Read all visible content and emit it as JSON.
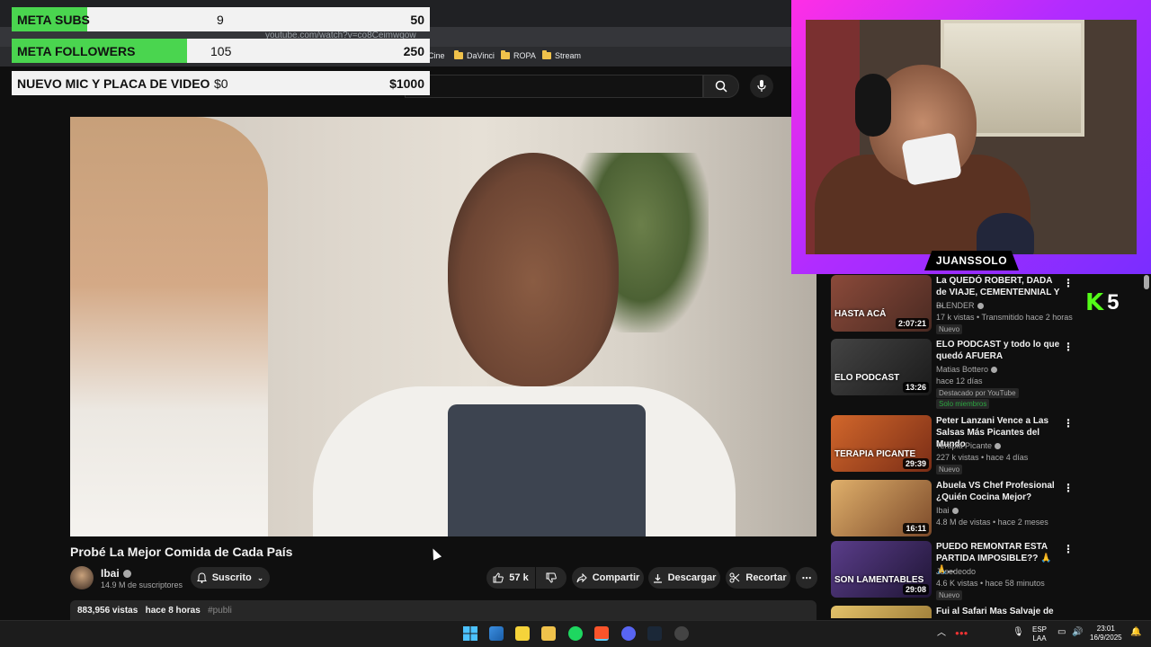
{
  "browser": {
    "url": "youtube.com/watch?v=co8Ceimwqow",
    "bookmarks": [
      "Cine",
      "DaVinci",
      "ROPA",
      "Stream"
    ]
  },
  "goals": [
    {
      "label": "META SUBS",
      "current": "9",
      "target": "50",
      "progress": 0.18
    },
    {
      "label": "META FOLLOWERS",
      "current": "105",
      "target": "250",
      "progress": 0.42
    },
    {
      "label": "NUEVO MIC Y PLACA DE VIDEO",
      "current": "$0",
      "target": "$1000",
      "progress": 0
    }
  ],
  "video": {
    "title": "Probé La Mejor Comida de Cada País",
    "channel": "Ibai",
    "subscribers": "14.9 M de suscriptores",
    "subscribed_label": "Suscrito",
    "likes": "57 k",
    "share_label": "Compartir",
    "download_label": "Descargar",
    "clip_label": "Recortar",
    "views": "883,956 vistas",
    "posted": "hace 8 horas",
    "hashtag": "#publi"
  },
  "stream": {
    "streamer_name": "JUANSSOLO",
    "kick_count": "5",
    "kick_logo": "K"
  },
  "recommendations": [
    {
      "title": "La QUEDÓ ROBERT, DADA de VIAJE, CEMENTENNIAL Y ...",
      "channel": "BLENDER",
      "meta": "17 k vistas • Transmitido hace 2 horas",
      "duration": "2:07:21",
      "badge": "Nuevo",
      "caption": "HASTA ACÁ",
      "thumb_color": "#6b3b2e"
    },
    {
      "title": "ELO PODCAST y todo lo que quedó AFUERA",
      "channel": "Matias Bottero",
      "meta": "hace 12 días",
      "duration": "13:26",
      "badge": "Destacado por YouTube",
      "badge2": "Solo miembros",
      "caption": "ELO PODCAST",
      "thumb_color": "#2f2f2f"
    },
    {
      "title": "Peter Lanzani Vence a Las Salsas Más Picantes del Mundo",
      "channel": "Terapia Picante",
      "meta": "227 k vistas • hace 4 días",
      "duration": "29:39",
      "badge": "Nuevo",
      "caption": "TERAPIA PICANTE",
      "thumb_color": "#b5451f"
    },
    {
      "title": "Abuela VS Chef Profesional ¿Quién Cocina Mejor?",
      "channel": "Ibai",
      "meta": "4.8 M de vistas • hace 2 meses",
      "duration": "16:11",
      "badge": "",
      "caption": "",
      "thumb_color": "#c99a5a"
    },
    {
      "title": "PUEDO REMONTAR ESTA PARTIDA IMPOSIBLE?? 🙏🙏...",
      "channel": "Josedeodo",
      "meta": "4.6 K vistas • hace 58 minutos",
      "duration": "29:08",
      "badge": "Nuevo",
      "caption": "SON LAMENTABLES",
      "thumb_color": "#3a2a55"
    },
    {
      "title": "Fui al Safari Mas Salvaje de",
      "channel": "",
      "meta": "",
      "duration": "",
      "badge": "",
      "caption": "",
      "thumb_color": "#d8b35a"
    }
  ],
  "taskbar": {
    "lang": "ESP",
    "region": "LAA",
    "time": "23:01",
    "date": "16/9/2025"
  }
}
